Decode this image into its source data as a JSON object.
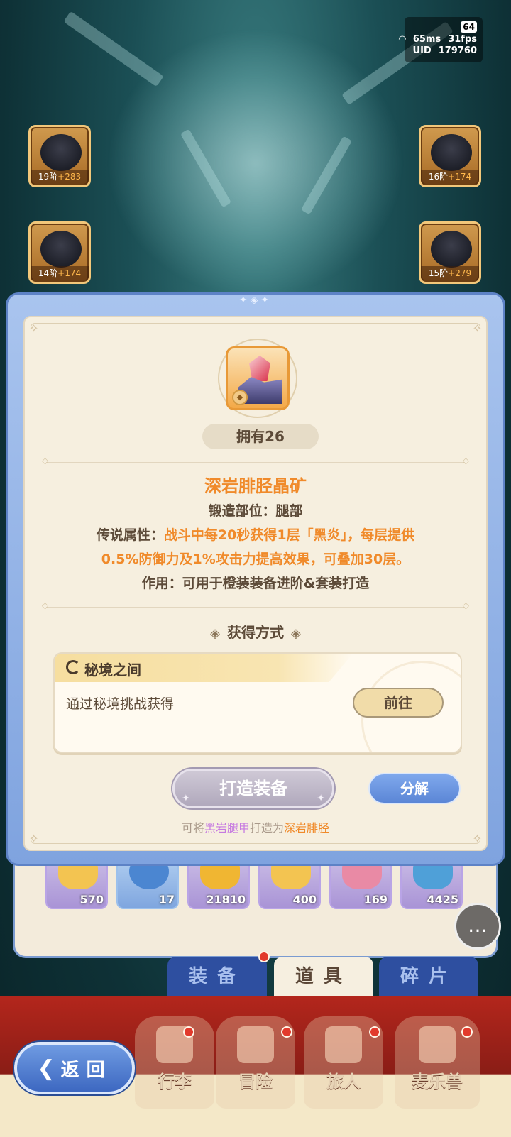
{
  "hud": {
    "battery": "64",
    "ping": "65ms",
    "fps": "31fps",
    "uid_label": "UID",
    "uid_value": "179760"
  },
  "equipment_slots": [
    {
      "level": "19阶",
      "bonus": "+283"
    },
    {
      "level": "16阶",
      "bonus": "+174"
    },
    {
      "level": "14阶",
      "bonus": "+174"
    },
    {
      "level": "15阶",
      "bonus": "+279"
    }
  ],
  "inventory_counts": [
    "570",
    "17",
    "21810",
    "400",
    "169",
    "4425"
  ],
  "modal": {
    "owned": "拥有26",
    "item_name": "深岩腓胫晶矿",
    "forge_slot_label": "锻造部位：",
    "forge_slot_value": "腿部",
    "legend_label": "传说属性：",
    "legend_line1": "战斗中每20秒获得1层「黑炎」，每层提供",
    "legend_line2": "0.5%防御力及1%攻击力提高效果，可叠加30层。",
    "usage_label": "作用：",
    "usage_value": "可用于橙装装备进阶&套装打造",
    "acquire_title": "获得方式",
    "source": {
      "name": "秘境之间",
      "desc": "通过秘境挑战获得",
      "goto_label": "前往"
    },
    "forge_button": "打造装备",
    "decompose_button": "分解",
    "hint_prefix": "可将",
    "hint_from": "黑岩腿甲",
    "hint_mid": "打造为",
    "hint_to": "深岩腓胫"
  },
  "tabs": {
    "equipment": "装备",
    "items": "道具",
    "fragments": "碎片"
  },
  "nav": {
    "back": "返回",
    "bag": "行李",
    "adventure": "冒险",
    "traveler": "旅人",
    "pet": "麦乐兽"
  },
  "colors": {
    "accent_orange": "#f08a2a",
    "panel_bg": "#f6efdf",
    "frame_blue": "#7fa3df",
    "hint_purple": "#c67ae0"
  }
}
